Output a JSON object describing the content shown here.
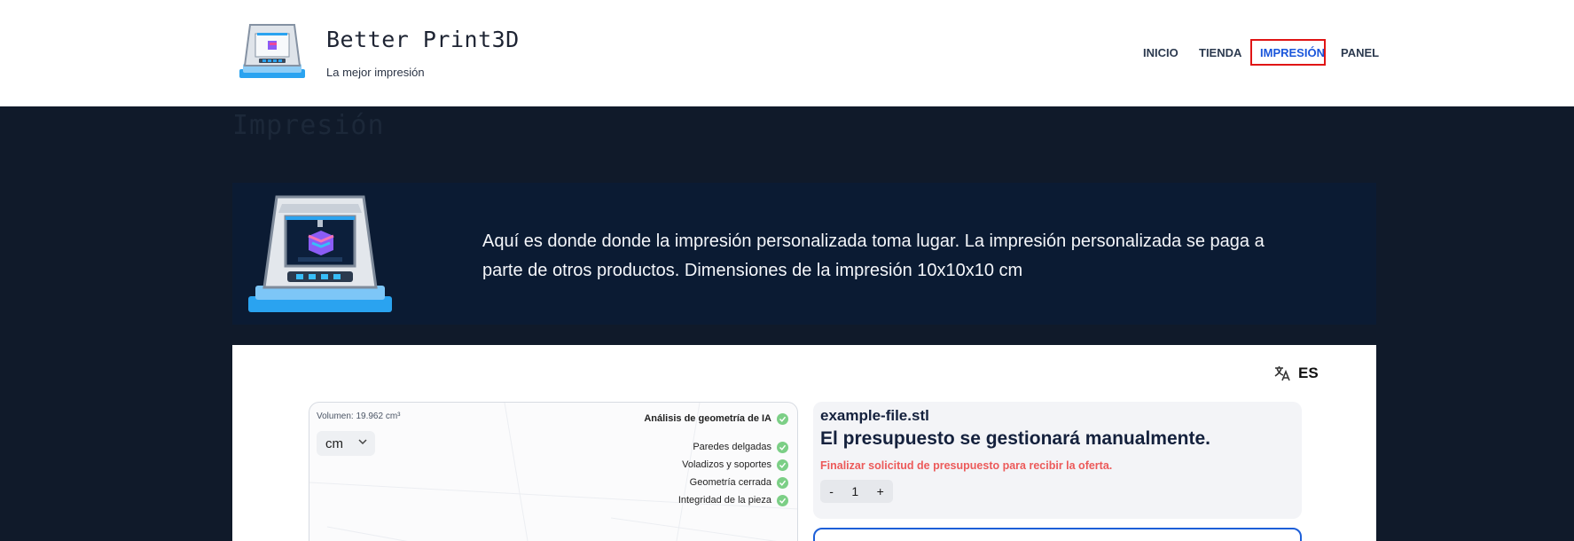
{
  "header": {
    "brand_title": "Better Print3D",
    "tagline": "La mejor impresión",
    "nav": [
      "INICIO",
      "TIENDA",
      "IMPRESIÓN",
      "PANEL"
    ],
    "active_nav": "IMPRESIÓN",
    "highlight_color": "#e01515"
  },
  "page": {
    "title": "Impresión"
  },
  "banner": {
    "text": "Aquí es donde donde la impresión personalizada toma lugar. La impresión personalizada se paga a parte de otros productos. Dimensiones de la impresión 10x10x10 cm"
  },
  "print_tool": {
    "language": "ES",
    "viewer": {
      "volume": "Volumen: 19.962 cm³",
      "unit": "cm",
      "analysis_title": "Análisis de geometría de IA",
      "checks": [
        "Paredes delgadas",
        "Voladizos y soportes",
        "Geometría cerrada",
        "Integridad de la pieza"
      ]
    },
    "quote": {
      "file_name": "example-file.stl",
      "title": "El presupuesto se gestionará manualmente.",
      "note": "Finalizar solicitud de presupuesto para recibir la oferta.",
      "qty_minus": "-",
      "qty_value": "1",
      "qty_plus": "+"
    }
  },
  "colors": {
    "header_bg": "#ffffff",
    "page_bg": "#101a2a",
    "banner_bg": "#0b1b33",
    "accent": "#1a56db",
    "check": "#7ccf86",
    "note": "#ec5a5a"
  }
}
